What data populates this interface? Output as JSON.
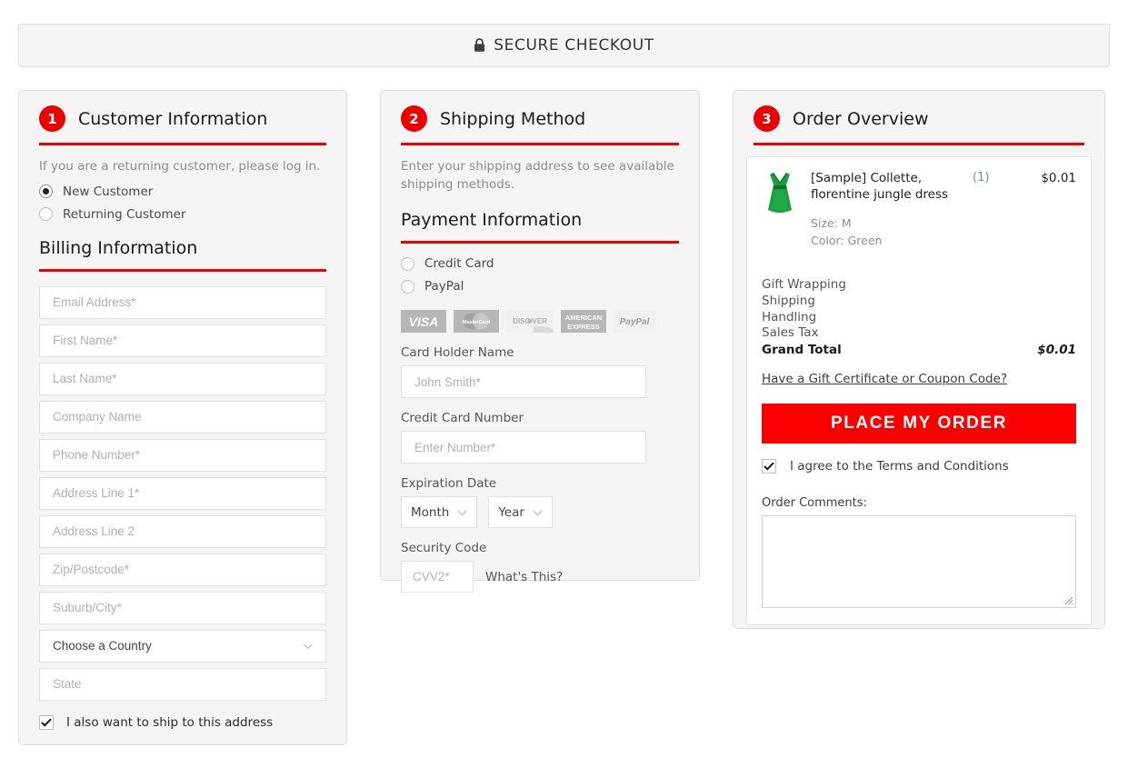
{
  "secure_bar": {
    "icon": "lock-icon",
    "label": "SECURE CHECKOUT"
  },
  "customer": {
    "step": "1",
    "title": "Customer Information",
    "login_note": "If you are a returning customer, please log in.",
    "options": [
      {
        "label": "New Customer",
        "checked": true
      },
      {
        "label": "Returning Customer",
        "checked": false
      }
    ],
    "billing_heading": "Billing Information",
    "fields": [
      {
        "placeholder": "Email Address*",
        "name": "email-field",
        "type": "text"
      },
      {
        "placeholder": "First Name*",
        "name": "first-name-field",
        "type": "text"
      },
      {
        "placeholder": "Last Name*",
        "name": "last-name-field",
        "type": "text"
      },
      {
        "placeholder": "Company Name",
        "name": "company-name-field",
        "type": "text"
      },
      {
        "placeholder": "Phone Number*",
        "name": "phone-number-field",
        "type": "text"
      },
      {
        "placeholder": "Address Line 1*",
        "name": "address-line-1-field",
        "type": "text"
      },
      {
        "placeholder": "Address Line 2",
        "name": "address-line-2-field",
        "type": "text"
      },
      {
        "placeholder": "Zip/Postcode*",
        "name": "zip-postcode-field",
        "type": "text"
      },
      {
        "placeholder": "Suburb/City*",
        "name": "suburb-city-field",
        "type": "text"
      },
      {
        "placeholder": "Choose a Country",
        "name": "country-select",
        "type": "select"
      },
      {
        "placeholder": "State",
        "name": "state-field",
        "type": "text"
      }
    ],
    "ship_same_label": "I also want to ship to this address",
    "ship_same_checked": true
  },
  "shipping": {
    "step": "2",
    "title": "Shipping Method",
    "note": "Enter your shipping address to see available shipping methods.",
    "payment_heading": "Payment Information",
    "payment_options": [
      {
        "label": "Credit Card",
        "checked": false
      },
      {
        "label": "PayPal",
        "checked": false
      }
    ],
    "card_logos": [
      "VISA",
      "MasterCard",
      "DISCOVER",
      "AMERICAN EXPRESS",
      "PayPal"
    ],
    "card_holder_label": "Card Holder Name",
    "card_holder_placeholder": "John Smith*",
    "card_number_label": "Credit Card Number",
    "card_number_placeholder": "Enter Number*",
    "expiration_label": "Expiration Date",
    "month_value": "Month",
    "year_value": "Year",
    "security_label": "Security Code",
    "cvv_placeholder": "CVV2*",
    "whats_this": "What's This?"
  },
  "order": {
    "step": "3",
    "title": "Order Overview",
    "product": {
      "name": "[Sample] Collette, florentine jungle dress",
      "qty": "(1)",
      "price": "$0.01",
      "options": [
        "Size: M",
        "Color: Green"
      ],
      "image": "green-dress-thumbnail"
    },
    "totals": [
      {
        "label": "Gift Wrapping",
        "value": ""
      },
      {
        "label": "Shipping",
        "value": ""
      },
      {
        "label": "Handling",
        "value": ""
      },
      {
        "label": "Sales Tax",
        "value": ""
      },
      {
        "label": "Grand Total",
        "value": "$0.01"
      }
    ],
    "coupon_link": "Have a Gift Certificate or Coupon Code?",
    "place_order_label": "PLACE MY ORDER",
    "terms_label": "I agree to the Terms and Conditions",
    "terms_checked": true,
    "comments_label": "Order Comments:",
    "comments_value": ""
  },
  "colors": {
    "accent_red": "#ee0000",
    "button_red": "#fb0000",
    "panel_bg": "#f4f4f4"
  }
}
